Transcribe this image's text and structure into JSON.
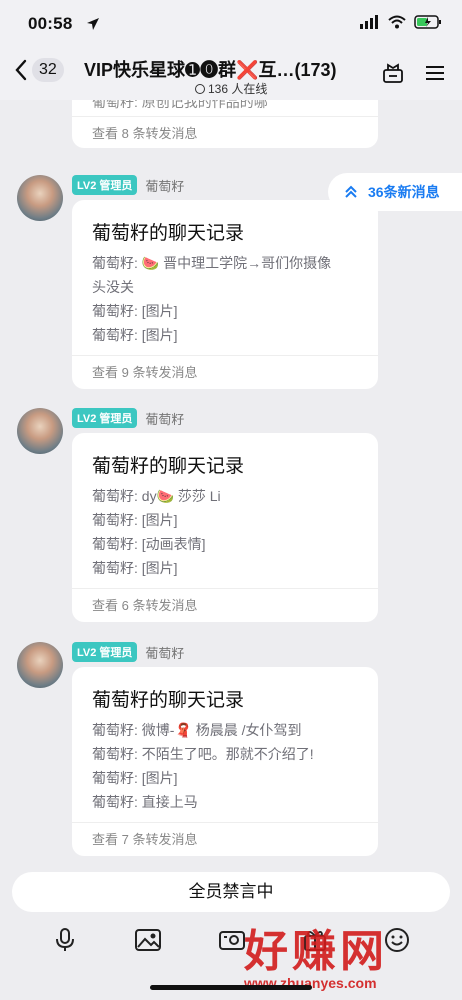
{
  "status": {
    "time": "00:58"
  },
  "nav": {
    "back_count": "32",
    "title": "VIP快乐星球➊⓿群❌互…(173)",
    "online": "136 人在线"
  },
  "top_card": {
    "line": "葡萄籽: 原创记我的作品的哪",
    "footer": "查看 8 条转发消息"
  },
  "new_messages": {
    "label": "36条新消息"
  },
  "messages": [
    {
      "badge": "LV2 管理员",
      "sender": "葡萄籽",
      "title": "葡萄籽的聊天记录",
      "lines": [
        "葡萄籽: 🍉 晋中理工学院→哥们你摄像",
        "头没关",
        "葡萄籽: [图片]",
        "葡萄籽: [图片]"
      ],
      "footer": "查看 9 条转发消息"
    },
    {
      "badge": "LV2 管理员",
      "sender": "葡萄籽",
      "title": "葡萄籽的聊天记录",
      "lines": [
        "葡萄籽: dy🍉 莎莎 Li",
        "葡萄籽: [图片]",
        "葡萄籽: [动画表情]",
        "葡萄籽: [图片]"
      ],
      "footer": "查看 6 条转发消息"
    },
    {
      "badge": "LV2 管理员",
      "sender": "葡萄籽",
      "title": "葡萄籽的聊天记录",
      "lines": [
        "葡萄籽: 微博-🧣 杨晨晨 /女仆驾到",
        "葡萄籽: 不陌生了吧。那就不介绍了!",
        "葡萄籽: [图片]",
        "葡萄籽: 直接上马"
      ],
      "footer": "查看 7 条转发消息"
    }
  ],
  "mute_label": "全员禁言中",
  "toolbar": {
    "icons": [
      "microphone-icon",
      "image-icon",
      "camera-icon",
      "gift-icon",
      "emoji-icon"
    ]
  },
  "watermark": {
    "text": "好赚网",
    "url": "www.zhuanyes.com"
  }
}
